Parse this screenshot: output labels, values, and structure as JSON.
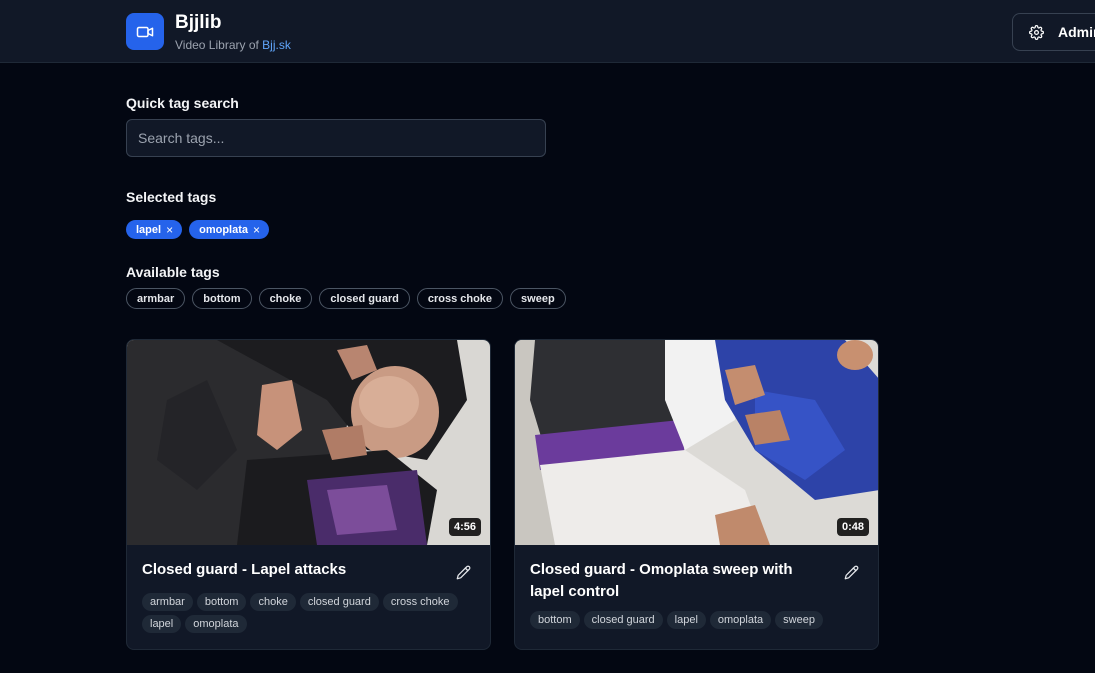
{
  "header": {
    "title": "Bjjlib",
    "subtitle_prefix": "Video Library of ",
    "subtitle_link": "Bjj.sk",
    "logo_icon": "video-camera-icon",
    "admin_label": "Admin",
    "admin_icon": "gear-icon"
  },
  "search": {
    "label": "Quick tag search",
    "placeholder": "Search tags..."
  },
  "selected": {
    "label": "Selected tags",
    "tags": [
      "lapel",
      "omoplata"
    ],
    "remove_glyph": "×"
  },
  "available": {
    "label": "Available tags",
    "tags": [
      "armbar",
      "bottom",
      "choke",
      "closed guard",
      "cross choke",
      "sweep"
    ]
  },
  "videos": [
    {
      "title": "Closed guard - Lapel attacks",
      "duration": "4:56",
      "tags": [
        "armbar",
        "bottom",
        "choke",
        "closed guard",
        "cross choke",
        "lapel",
        "omoplata"
      ]
    },
    {
      "title": "Closed guard - Omoplata sweep with lapel control",
      "duration": "0:48",
      "tags": [
        "bottom",
        "closed guard",
        "lapel",
        "omoplata",
        "sweep"
      ]
    }
  ],
  "colors": {
    "accent": "#2563eb",
    "background": "#030712",
    "surface": "#111827"
  }
}
